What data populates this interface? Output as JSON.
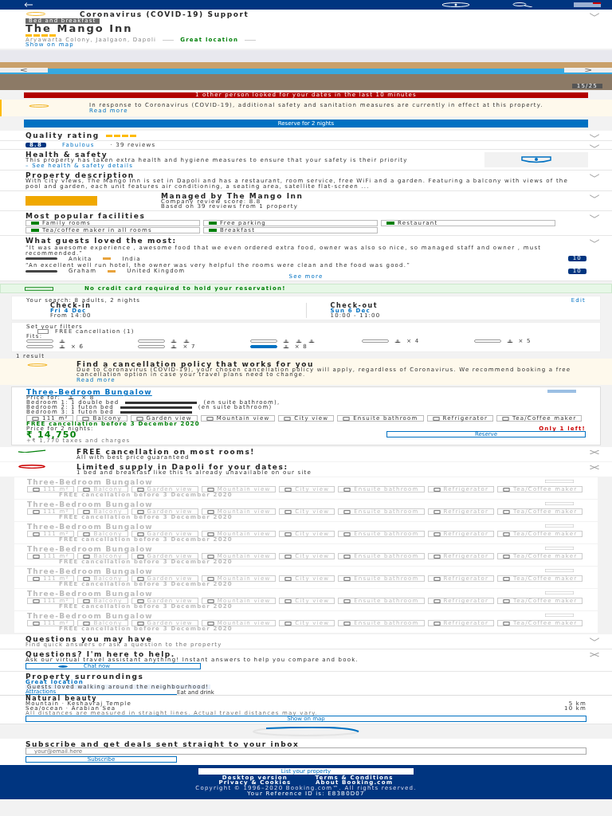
{
  "covid_banner": {
    "title": "Coronavirus (COVID-19) Support"
  },
  "property": {
    "type": "Bed and breakfast",
    "name": "The Mango Inn",
    "stars": 4,
    "address": "Aryawarta Colony, Jaalgaon, Dapoli",
    "location_badge": "Great location",
    "map_link": "Show on map",
    "photo_counter": "15/25"
  },
  "urgency": "1 other person looked for your dates in the last 10 minutes",
  "covid_notice": {
    "text": "In response to Coronavirus (COVID-19), additional safety and sanitation measures are currently in effect at this property.",
    "link": "Read more"
  },
  "reserve_button": "Reserve for 2 nights",
  "quality": {
    "title": "Quality rating",
    "stars": 4
  },
  "reviews_summary": {
    "score": "8.8",
    "label": "Fabulous",
    "count": "· 39 reviews"
  },
  "health": {
    "title": "Health & safety",
    "text": "This property has taken extra health and hygiene measures to ensure that your safety is their priority",
    "link": "– See health & safety details"
  },
  "description": {
    "title": "Property description",
    "text": "With city views, The Mango Inn is set in Dapoli and has a restaurant, room service, free WiFi and a garden. Featuring a balcony with views of the pool and garden, each unit features air conditioning, a seating area, satellite flat-screen ..."
  },
  "manager": {
    "title": "Managed by The Mango Inn",
    "score": "Company review score: 8.8",
    "based_on": "Based on 39 reviews from 1 property"
  },
  "facilities": {
    "title": "Most popular facilities",
    "items": [
      "Family rooms",
      "Free parking",
      "Restaurant",
      "Tea/coffee maker in all rooms",
      "Breakfast"
    ]
  },
  "guest_reviews": {
    "title": "What guests loved the most:",
    "items": [
      {
        "quote": "“It was awesome experience , awesome food that we even ordered extra food, owner was also so nice, so managed staff and owner , must recommended.”",
        "name": "Ankita",
        "country": "India",
        "score": "10"
      },
      {
        "quote": "“An excellent well run hotel, the owner was very helpful the rooms were clean and the food was good.”",
        "name": "Graham",
        "country": "United Kingdom",
        "score": "10"
      }
    ],
    "more": "See more"
  },
  "no_card": "No credit card required to hold your reservation!",
  "search": {
    "summary": "Your search: 8 adults, 2 nights",
    "edit": "Edit",
    "checkin_label": "Check-in",
    "checkin_date": "Fri 4 Dec",
    "checkin_time": "From 14:00",
    "checkout_label": "Check-out",
    "checkout_date": "Sun 6 Dec",
    "checkout_time": "10:00 - 11:00"
  },
  "filters": {
    "title": "Set your filters",
    "free_cancellation": {
      "label": "FREE cancellation (1)",
      "checked": false
    },
    "fits_label": "Fits:",
    "options": [
      {
        "kind": "one",
        "selected": false
      },
      {
        "kind": "two",
        "selected": false
      },
      {
        "kind": "three",
        "selected": false
      },
      {
        "kind": "multi",
        "label": "× 4",
        "selected": false
      },
      {
        "kind": "multi",
        "label": "× 5",
        "selected": false
      },
      {
        "kind": "multi",
        "label": "× 6",
        "selected": false
      },
      {
        "kind": "multi",
        "label": "× 7",
        "selected": false
      },
      {
        "kind": "multi",
        "label": "× 8",
        "selected": true
      }
    ]
  },
  "results_count": "1 result",
  "policy": {
    "title": "Find a cancellation policy that works for you",
    "text": "Due to Coronavirus (COVID-19), your chosen cancellation policy will apply, regardless of Coronavirus. We recommend booking a free cancellation option in case your travel plans need to change.",
    "link": "Read more"
  },
  "room": {
    "name": "Three-Bedroom Bungalow",
    "price_for": "Price for:",
    "occupancy": "× 8",
    "beds": [
      "Bedroom 1: 1 double bed",
      "(en suite bathroom),",
      "Bedroom 2: 1 futon bed",
      "(en suite bathroom)",
      "Bedroom 3: 1 futon bed"
    ],
    "chips": [
      "111 m²",
      "Balcony",
      "Garden view",
      "Mountain view",
      "City view",
      "Ensuite bathroom",
      "Refrigerator",
      "Tea/Coffee maker"
    ],
    "cancellation": "FREE cancellation before 3 December 2020",
    "price_label": "Price for 2 nights:",
    "price": "₹ 14,750",
    "taxes": "+₹ 1,770 taxes and charges",
    "scarcity": "Only 1 left!",
    "reserve": "Reserve"
  },
  "perks": [
    {
      "kind": "check",
      "title": "FREE cancellation on most rooms!",
      "text": "All with best price guaranteed"
    },
    {
      "kind": "alert",
      "title": "Limited supply in Dapoli for your dates:",
      "text": "1 bed and breakfast like this is already unavailable on our site"
    }
  ],
  "unavailable_rooms": [
    {
      "name": "Three-Bedroom Bungalow",
      "unavailable": true,
      "chips": [
        "111 m²",
        "Balcony",
        "Garden view",
        "Mountain view",
        "City view",
        "Ensuite bathroom",
        "Refrigerator",
        "Tea/Coffee maker"
      ],
      "cancellation": "FREE cancellation before 3 December 2020"
    },
    {
      "name": "Three-Bedroom Bungalow",
      "unavailable": true,
      "chips": [
        "111 m²",
        "Balcony",
        "Garden view",
        "Mountain view",
        "City view",
        "Ensuite bathroom",
        "Refrigerator",
        "Tea/Coffee maker"
      ],
      "cancellation": "FREE cancellation before 3 December 2020"
    },
    {
      "name": "Three-Bedroom Bungalow",
      "unavailable": true,
      "chips": [
        "111 m²",
        "Balcony",
        "Garden view",
        "Mountain view",
        "City view",
        "Ensuite bathroom",
        "Refrigerator",
        "Tea/Coffee maker"
      ],
      "cancellation": "FREE cancellation before 3 December 2020"
    },
    {
      "name": "Three-Bedroom Bungalow",
      "unavailable": true,
      "chips": [
        "111 m²",
        "Balcony",
        "Garden view",
        "Mountain view",
        "City view",
        "Ensuite bathroom",
        "Refrigerator",
        "Tea/Coffee maker"
      ],
      "cancellation": "FREE cancellation before 3 December 2020"
    },
    {
      "name": "Three-Bedroom Bungalow",
      "unavailable": true,
      "chips": [
        "111 m²",
        "Balcony",
        "Garden view",
        "Mountain view",
        "City view",
        "Ensuite bathroom",
        "Refrigerator",
        "Tea/Coffee maker"
      ],
      "cancellation": "FREE cancellation before 3 December 2020"
    },
    {
      "name": "Three-Bedroom Bungalow",
      "unavailable": true,
      "chips": [
        "111 m²",
        "Balcony",
        "Garden view",
        "Mountain view",
        "City view",
        "Ensuite bathroom",
        "Refrigerator",
        "Tea/Coffee maker"
      ],
      "cancellation": "FREE cancellation before 3 December 2020"
    },
    {
      "name": "Three-Bedroom Bungalow",
      "unavailable": true,
      "chips": [
        "111 m²",
        "Balcony",
        "Garden view",
        "Mountain view",
        "City view",
        "Ensuite bathroom",
        "Refrigerator",
        "Tea/Coffee maker"
      ],
      "cancellation": "FREE cancellation before 3 December 2020"
    }
  ],
  "questions": {
    "title": "Questions you may have",
    "text": "Find quick answers or ask a question to the property"
  },
  "assistant": {
    "title": "Questions? I'm here to help.",
    "text": "Ask our virtual travel assistant anything! Instant answers to help you compare and book.",
    "button": "Chat now"
  },
  "surroundings": {
    "title": "Property surroundings",
    "location": "Great location",
    "highlight": "Guests loved walking around the neighbourhood!",
    "tabs": [
      {
        "label": "Attractions",
        "selected": true
      },
      {
        "label": "Eat and drink",
        "selected": false
      }
    ],
    "group": "Natural beauty",
    "places": [
      {
        "name": "Mountain · Keshavraj Temple",
        "distance": "5 km"
      },
      {
        "name": "Sea/ocean · Arabian Sea",
        "distance": "10 km"
      }
    ],
    "note": "All distances are measured in straight lines. Actual travel distances may vary.",
    "map_button": "Show on map"
  },
  "subscribe": {
    "title": "Subscribe and get deals sent straight to your inbox",
    "placeholder": "your@email.here",
    "button": "Subscribe"
  },
  "footer": {
    "list_property": "List your property",
    "links": [
      "Desktop version",
      "Terms & Conditions",
      "Privacy & Cookies",
      "About Booking.com"
    ],
    "copyright": "Copyright © 1996–2020 Booking.com™. All rights reserved.",
    "reference": "Your Reference ID is: E83B0D07"
  }
}
